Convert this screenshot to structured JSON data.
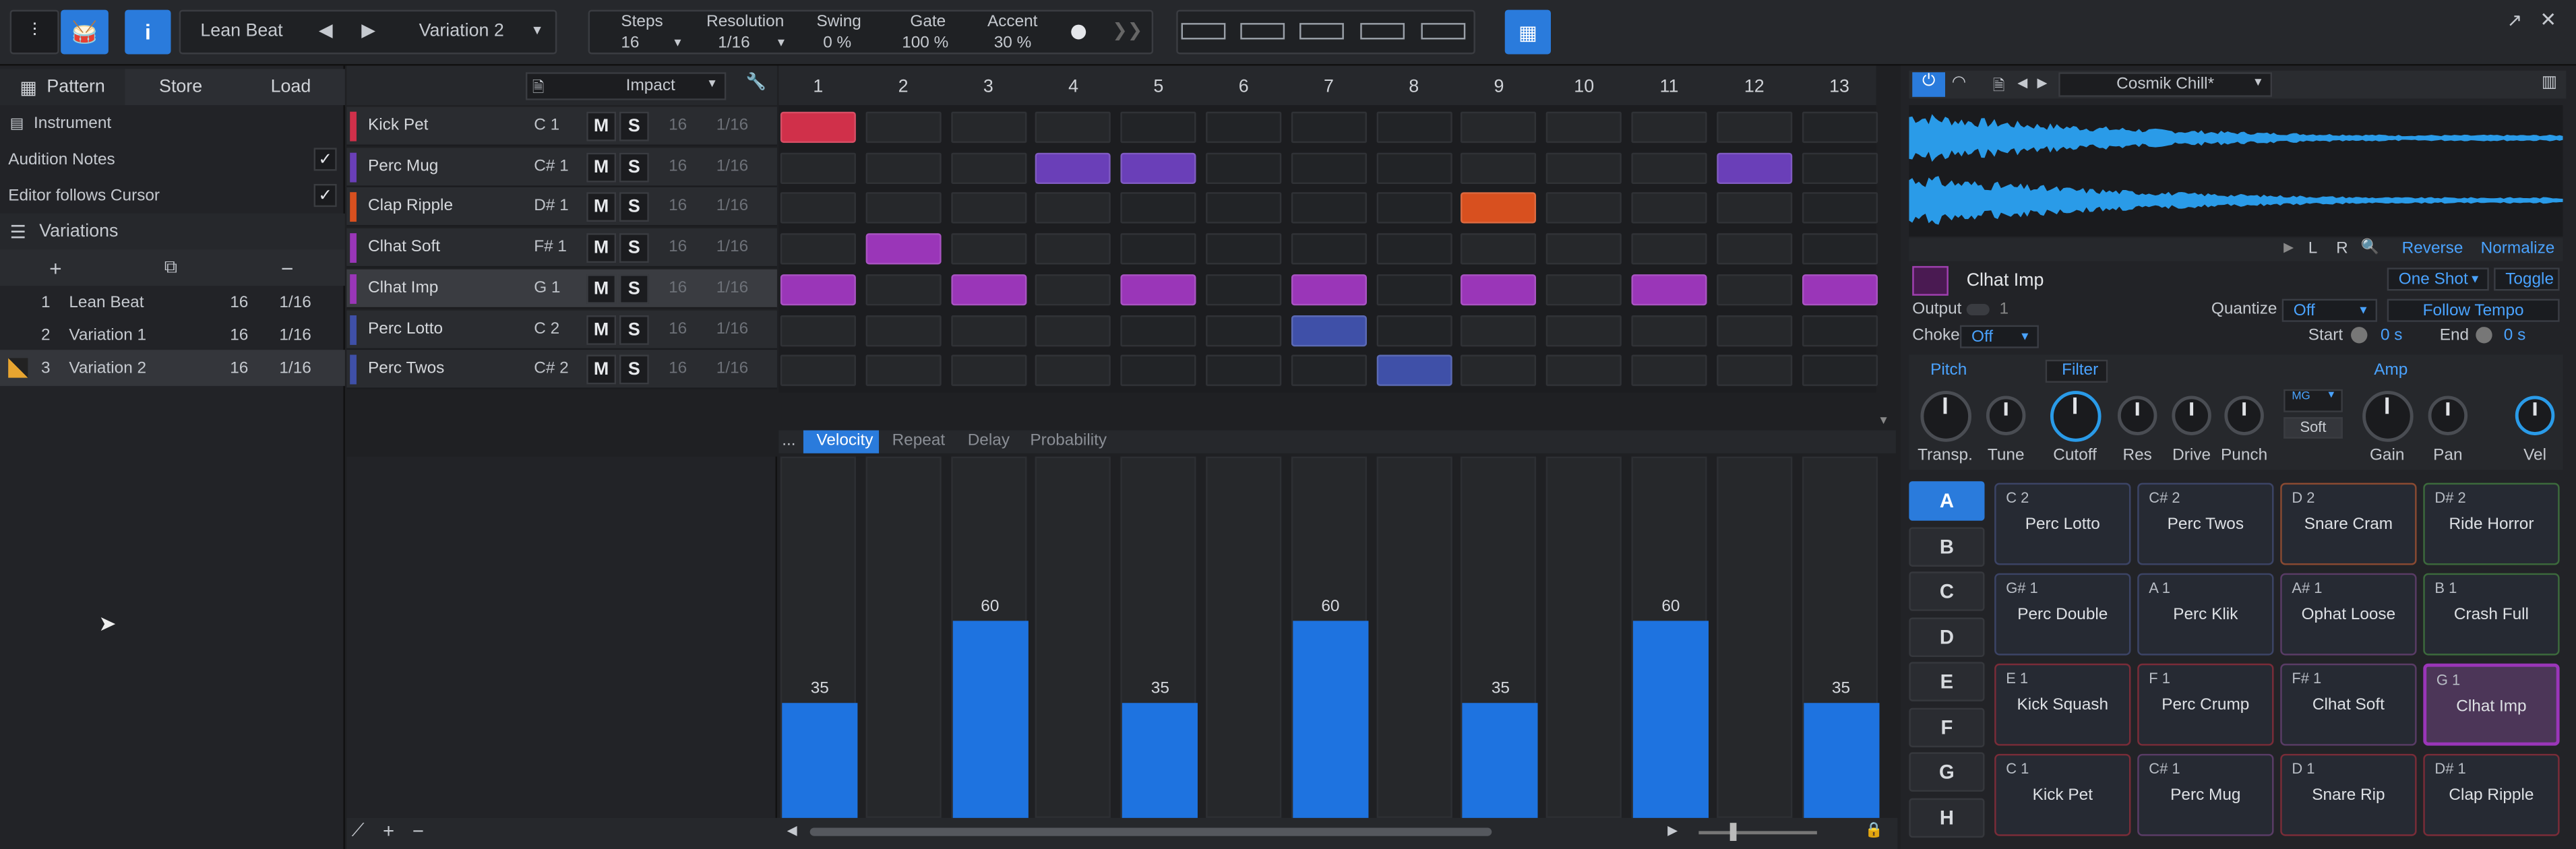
{
  "header": {
    "pattern_name": "Lean Beat",
    "variation": "Variation 2",
    "steps_label": "Steps",
    "steps": "16",
    "resolution_label": "Resolution",
    "resolution": "1/16",
    "swing_label": "Swing",
    "swing": "0 %",
    "gate_label": "Gate",
    "gate": "100 %",
    "accent_label": "Accent",
    "accent": "30 %",
    "info": "i"
  },
  "left": {
    "tabs": [
      "Pattern",
      "Store",
      "Load"
    ],
    "instrument": "Instrument",
    "audition": "Audition Notes",
    "editor_follow": "Editor follows Cursor",
    "variations_label": "Variations",
    "variations": [
      {
        "n": "1",
        "name": "Lean Beat",
        "steps": "16",
        "res": "1/16"
      },
      {
        "n": "2",
        "name": "Variation 1",
        "steps": "16",
        "res": "1/16"
      },
      {
        "n": "3",
        "name": "Variation 2",
        "steps": "16",
        "res": "1/16"
      }
    ]
  },
  "editor": {
    "kit": "Impact",
    "columns": [
      "1",
      "2",
      "3",
      "4",
      "5",
      "6",
      "7",
      "8",
      "9",
      "10",
      "11",
      "12",
      "13"
    ],
    "instruments": [
      {
        "name": "Kick Pet",
        "note": "C 1",
        "steps": "16",
        "res": "1/16",
        "color": "#d0304a",
        "on": [
          0
        ]
      },
      {
        "name": "Perc Mug",
        "note": "C# 1",
        "steps": "16",
        "res": "1/16",
        "color": "#6a3fb8",
        "on": [
          3,
          4,
          11
        ]
      },
      {
        "name": "Clap Ripple",
        "note": "D# 1",
        "steps": "16",
        "res": "1/16",
        "color": "#d8501f",
        "on": [
          8
        ]
      },
      {
        "name": "Clhat Soft",
        "note": "F# 1",
        "steps": "16",
        "res": "1/16",
        "color": "#9a36b8",
        "on": [
          1
        ]
      },
      {
        "name": "Clhat Imp",
        "note": "G 1",
        "steps": "16",
        "res": "1/16",
        "color": "#9a36b8",
        "on": [
          0,
          2,
          4,
          6,
          8,
          10,
          12
        ]
      },
      {
        "name": "Perc Lotto",
        "note": "C 2",
        "steps": "16",
        "res": "1/16",
        "color": "#3f50a8",
        "on": [
          6
        ]
      },
      {
        "name": "Perc Twos",
        "note": "C# 2",
        "steps": "16",
        "res": "1/16",
        "color": "#3f50a8",
        "on": [
          7
        ]
      }
    ],
    "mute": "M",
    "solo": "S",
    "lanes": [
      "...",
      "Velocity",
      "Repeat",
      "Delay",
      "Probability"
    ],
    "velocities": [
      35,
      null,
      60,
      null,
      35,
      null,
      60,
      null,
      35,
      null,
      60,
      null,
      35
    ]
  },
  "right": {
    "preset": "Cosmik Chill*",
    "L": "L",
    "R": "R",
    "reverse": "Reverse",
    "normalize": "Normalize",
    "pad_name": "Clhat Imp",
    "mode": "One Shot",
    "toggle": "Toggle",
    "output_label": "Output",
    "output": "1",
    "quantize_label": "Quantize",
    "quantize": "Off",
    "follow_tempo": "Follow Tempo",
    "choke_label": "Choke",
    "choke": "Off",
    "start_label": "Start",
    "start": "0 s",
    "end_label": "End",
    "end": "0 s",
    "pitch": "Pitch",
    "filter": "Filter",
    "amp": "Amp",
    "mg": "MG",
    "soft": "Soft",
    "knobs": [
      "Transp.",
      "Tune",
      "Cutoff",
      "Res",
      "Drive",
      "Punch",
      "Gain",
      "Pan",
      "Vel"
    ],
    "banks": [
      "A",
      "B",
      "C",
      "D",
      "E",
      "F",
      "G",
      "H"
    ],
    "pads": [
      {
        "note": "C 2",
        "name": "Perc Lotto",
        "c": "#3c4466"
      },
      {
        "note": "C# 2",
        "name": "Perc Twos",
        "c": "#3c4466"
      },
      {
        "note": "D 2",
        "name": "Snare Cram",
        "c": "#8a4a32"
      },
      {
        "note": "D# 2",
        "name": "Ride Horror",
        "c": "#3c6a3c"
      },
      {
        "note": "G# 1",
        "name": "Perc Double",
        "c": "#3c4466"
      },
      {
        "note": "A 1",
        "name": "Perc Klik",
        "c": "#3c4466"
      },
      {
        "note": "A# 1",
        "name": "Ophat Loose",
        "c": "#5a3c66"
      },
      {
        "note": "B 1",
        "name": "Crash Full",
        "c": "#3c6a3c"
      },
      {
        "note": "E 1",
        "name": "Kick Squash",
        "c": "#7a2c38"
      },
      {
        "note": "F 1",
        "name": "Perc Crump",
        "c": "#7a2c38"
      },
      {
        "note": "F# 1",
        "name": "Clhat Soft",
        "c": "#5a3c66"
      },
      {
        "note": "G 1",
        "name": "Clhat Imp",
        "c": "#9a36b8"
      },
      {
        "note": "C 1",
        "name": "Kick Pet",
        "c": "#7a2c38"
      },
      {
        "note": "C# 1",
        "name": "Perc Mug",
        "c": "#5a3c66"
      },
      {
        "note": "D 1",
        "name": "Snare Rip",
        "c": "#7a2c38"
      },
      {
        "note": "D# 1",
        "name": "Clap Ripple",
        "c": "#7a2c38"
      }
    ]
  }
}
